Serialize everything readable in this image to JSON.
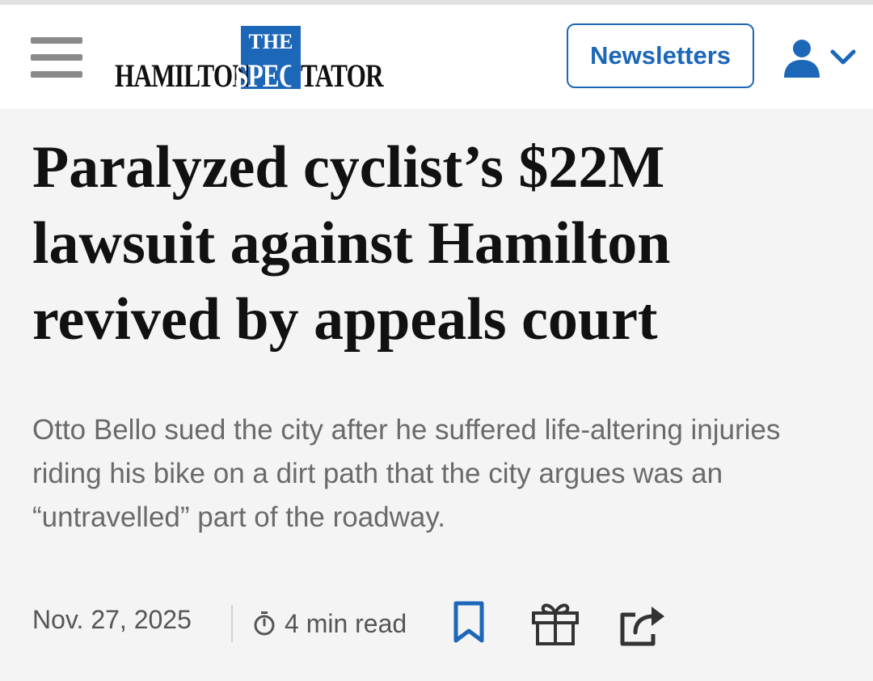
{
  "header": {
    "menu_icon": "hamburger-menu-icon",
    "logo": {
      "the": "THE",
      "word_left": "HAMILTON",
      "word_spec": "SPEC",
      "word_right": "TATOR",
      "brand_color": "#1d67b8"
    },
    "newsletters_label": "Newsletters",
    "account_icon": "user-icon",
    "account_chevron": "chevron-down-icon"
  },
  "article": {
    "headline": "Paralyzed cyclist’s $22M lawsuit against Hamilton revived by appeals court",
    "dek": "Otto Bello sued the city after he suffered life-altering injuries riding his bike on a dirt path that the city argues was an “untravelled” part of the roadway.",
    "date": "Nov. 27, 2025",
    "read_time": "4 min read"
  },
  "actions": {
    "bookmark_icon": "bookmark-icon",
    "gift_icon": "gift-icon",
    "share_icon": "share-icon"
  },
  "colors": {
    "accent": "#1d67b8",
    "headline": "#111111",
    "dek": "#6a6a6a",
    "meta": "#555555"
  }
}
